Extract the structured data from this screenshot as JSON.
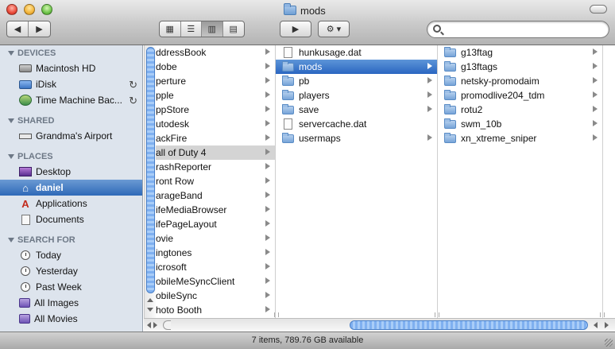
{
  "window": {
    "title": "mods"
  },
  "toolbar": {
    "back_icon": "back-arrow-icon",
    "forward_icon": "forward-arrow-icon",
    "views": [
      "icon-view",
      "list-view",
      "column-view",
      "coverflow-view"
    ],
    "active_view": "column-view",
    "quicklook_icon": "quicklook-eye-icon",
    "action_icon": "gear-icon",
    "search_placeholder": ""
  },
  "sidebar": {
    "sections": [
      {
        "title": "DEVICES",
        "items": [
          {
            "label": "Macintosh HD",
            "icon": "hard-disk-icon"
          },
          {
            "label": "iDisk",
            "icon": "idisk-icon",
            "accessory": "sync-icon"
          },
          {
            "label": "Time Machine Bac...",
            "icon": "time-machine-icon",
            "accessory": "sync-icon"
          }
        ]
      },
      {
        "title": "SHARED",
        "items": [
          {
            "label": "Grandma's Airport",
            "icon": "network-icon"
          }
        ]
      },
      {
        "title": "PLACES",
        "items": [
          {
            "label": "Desktop",
            "icon": "desktop-icon"
          },
          {
            "label": "daniel",
            "icon": "home-icon",
            "selected": true
          },
          {
            "label": "Applications",
            "icon": "applications-icon"
          },
          {
            "label": "Documents",
            "icon": "documents-icon"
          }
        ]
      },
      {
        "title": "SEARCH FOR",
        "items": [
          {
            "label": "Today",
            "icon": "clock-icon"
          },
          {
            "label": "Yesterday",
            "icon": "clock-icon"
          },
          {
            "label": "Past Week",
            "icon": "clock-icon"
          },
          {
            "label": "All Images",
            "icon": "smart-folder-icon"
          },
          {
            "label": "All Movies",
            "icon": "smart-folder-icon"
          }
        ]
      }
    ]
  },
  "columns": [
    {
      "items": [
        {
          "label": "ddressBook",
          "type": "folder",
          "arrow": true
        },
        {
          "label": "dobe",
          "type": "folder",
          "arrow": true
        },
        {
          "label": "perture",
          "type": "folder",
          "arrow": true
        },
        {
          "label": "pple",
          "type": "folder",
          "arrow": true
        },
        {
          "label": "ppStore",
          "type": "folder",
          "arrow": true
        },
        {
          "label": "utodesk",
          "type": "folder",
          "arrow": true
        },
        {
          "label": "ackFire",
          "type": "folder",
          "arrow": true
        },
        {
          "label": "all of Duty 4",
          "type": "folder",
          "arrow": true,
          "selected": "grey"
        },
        {
          "label": "rashReporter",
          "type": "folder",
          "arrow": true
        },
        {
          "label": "ront Row",
          "type": "folder",
          "arrow": true
        },
        {
          "label": "arageBand",
          "type": "folder",
          "arrow": true
        },
        {
          "label": "ifeMediaBrowser",
          "type": "folder",
          "arrow": true
        },
        {
          "label": "ifePageLayout",
          "type": "folder",
          "arrow": true
        },
        {
          "label": "ovie",
          "type": "folder",
          "arrow": true
        },
        {
          "label": "ingtones",
          "type": "folder",
          "arrow": true
        },
        {
          "label": "icrosoft",
          "type": "folder",
          "arrow": true
        },
        {
          "label": "obileMeSyncClient",
          "type": "folder",
          "arrow": true
        },
        {
          "label": "obileSync",
          "type": "folder",
          "arrow": true
        },
        {
          "label": "hoto Booth",
          "type": "folder",
          "arrow": true
        }
      ]
    },
    {
      "items": [
        {
          "label": "hunkusage.dat",
          "type": "file",
          "arrow": false
        },
        {
          "label": "mods",
          "type": "folder",
          "arrow": true,
          "selected": "blue"
        },
        {
          "label": "pb",
          "type": "folder",
          "arrow": true
        },
        {
          "label": "players",
          "type": "folder",
          "arrow": true
        },
        {
          "label": "save",
          "type": "folder",
          "arrow": true
        },
        {
          "label": "servercache.dat",
          "type": "file",
          "arrow": false
        },
        {
          "label": "usermaps",
          "type": "folder",
          "arrow": true
        }
      ]
    },
    {
      "items": [
        {
          "label": "g13ftag",
          "type": "folder",
          "arrow": true
        },
        {
          "label": "g13ftags",
          "type": "folder",
          "arrow": true
        },
        {
          "label": "netsky-promodaim",
          "type": "folder",
          "arrow": true
        },
        {
          "label": "promodlive204_tdm",
          "type": "folder",
          "arrow": true
        },
        {
          "label": "rotu2",
          "type": "folder",
          "arrow": true
        },
        {
          "label": "swm_10b",
          "type": "folder",
          "arrow": true
        },
        {
          "label": "xn_xtreme_sniper",
          "type": "folder",
          "arrow": true
        }
      ]
    }
  ],
  "status": {
    "text": "7 items, 789.76 GB available"
  }
}
